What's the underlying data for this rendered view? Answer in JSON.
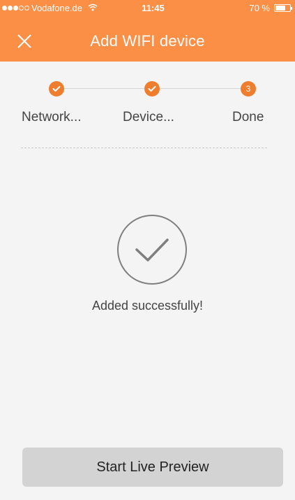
{
  "status_bar": {
    "carrier": "Vodafone.de",
    "time": "11:45",
    "battery_text": "70 %",
    "battery_level": 0.7,
    "signal_bars_on": 3,
    "signal_bars_total": 5
  },
  "header": {
    "title": "Add WIFI device",
    "close_icon": "close-icon",
    "background_color": "#fb8f46"
  },
  "stepper": {
    "steps": [
      {
        "label": "Network...",
        "state": "done",
        "marker": "check-icon"
      },
      {
        "label": "Device...",
        "state": "done",
        "marker": "check-icon"
      },
      {
        "label": "Done",
        "state": "current",
        "number": "3"
      }
    ],
    "accent_color": "#ee7d2e"
  },
  "result": {
    "icon": "checkmark-circle-icon",
    "message": "Added successfully!"
  },
  "actions": {
    "start_live_preview_label": "Start Live Preview"
  }
}
